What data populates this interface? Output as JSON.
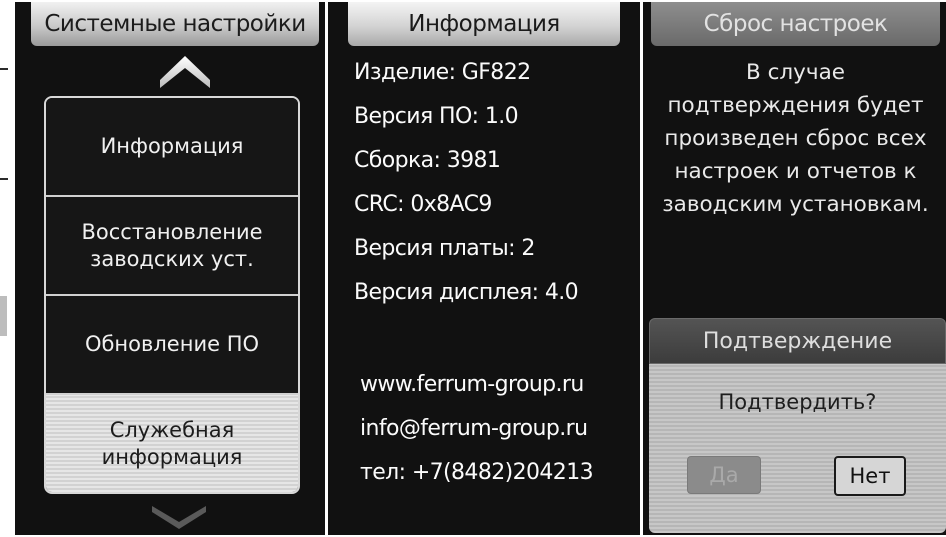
{
  "settings_screen": {
    "title": "Системные настройки",
    "menu_items": [
      {
        "label": "Информация",
        "selected": false
      },
      {
        "label": "Восстановление\nзаводских уст.",
        "selected": false
      },
      {
        "label": "Обновление ПО",
        "selected": false
      },
      {
        "label": "Служебная\nинформация",
        "selected": true
      }
    ]
  },
  "info_screen": {
    "title": "Информация",
    "lines": [
      "Изделие: GF822",
      "Версия ПО: 1.0",
      "Сборка: 3981",
      "CRC: 0x8AC9",
      "Версия платы: 2",
      "Версия дисплея: 4.0"
    ],
    "contacts": [
      "www.ferrum-group.ru",
      "info@ferrum-group.ru",
      "тел: +7(8482)204213"
    ]
  },
  "reset_screen": {
    "title": "Сброс настроек",
    "message": "В случае\nподтверждения будет\nпроизведен сброс всех\nнастроек и отчетов к\nзаводским установкам.",
    "dialog": {
      "title": "Подтверждение",
      "question": "Подтвердить?",
      "yes_label": "Да",
      "no_label": "Нет",
      "yes_enabled": false
    }
  },
  "icons": {
    "up": "chevron-up-icon",
    "down": "chevron-down-icon"
  }
}
